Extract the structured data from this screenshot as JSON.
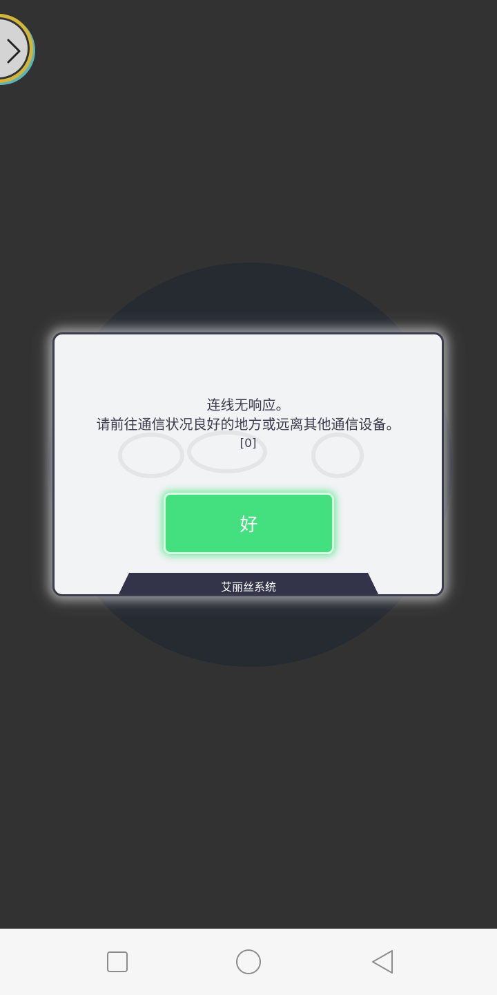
{
  "dialog": {
    "title": "连线无响应。",
    "message": "请前往通信状况良好的地方或远离其他通信设备。",
    "code": "[0]",
    "ok_label": "好",
    "footer_label": "艾丽丝系统"
  },
  "side_toggle": {
    "icon": "chevron-right-icon"
  },
  "navbar": {
    "recent_icon": "square-icon",
    "home_icon": "circle-icon",
    "back_icon": "triangle-back-icon"
  },
  "colors": {
    "background": "#323232",
    "dialog_bg": "#f2f3f5",
    "dialog_border": "#3a3b4d",
    "accent_green": "#44e07f",
    "footer_tab": "#33344a"
  }
}
